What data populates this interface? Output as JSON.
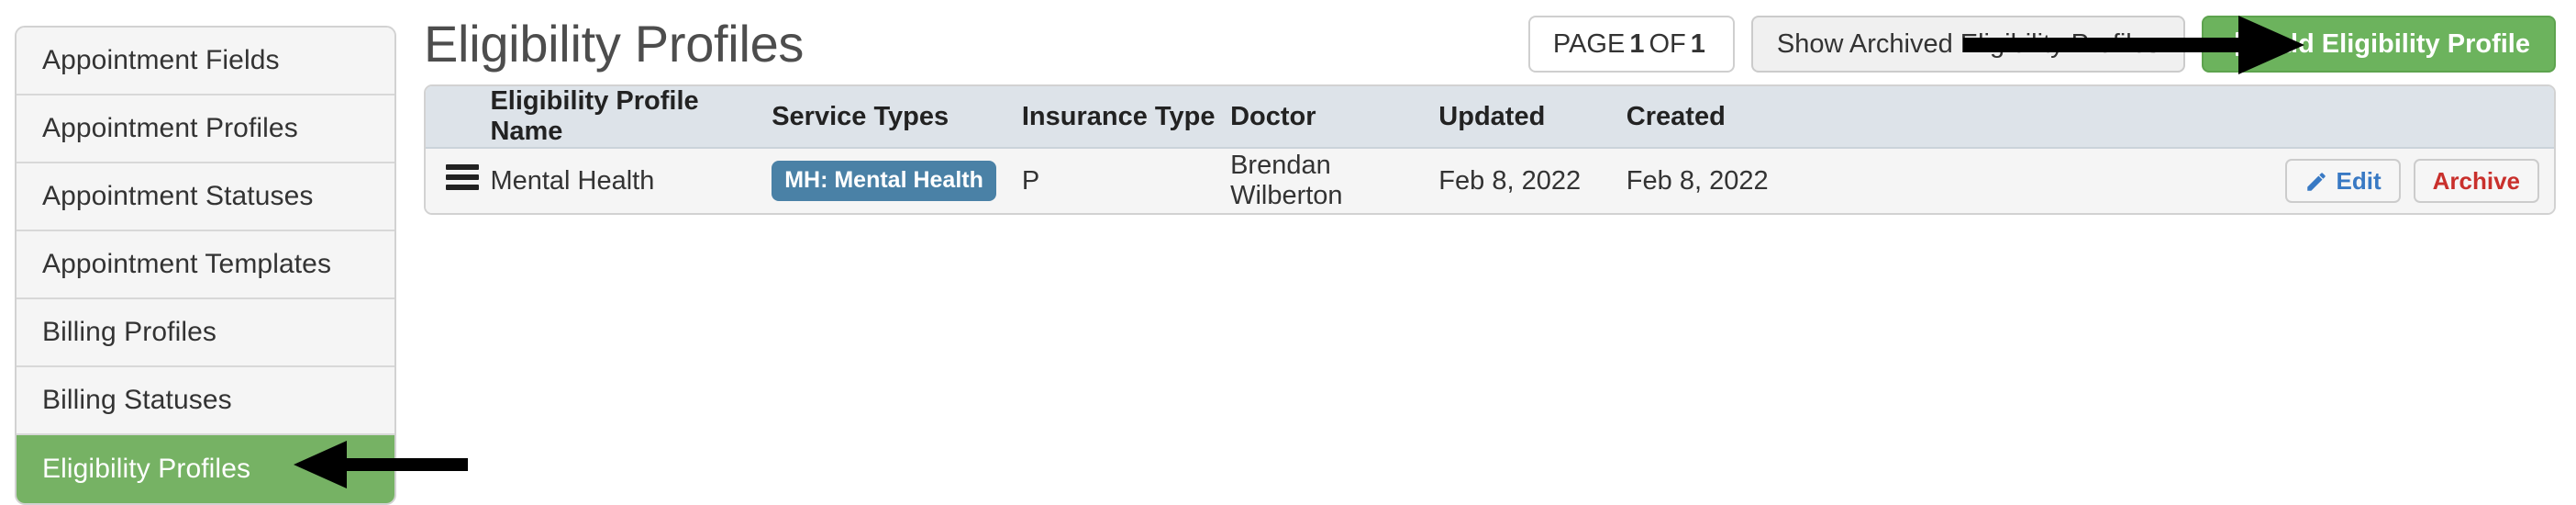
{
  "sidebar": {
    "items": [
      {
        "label": "Appointment Fields",
        "active": false
      },
      {
        "label": "Appointment Profiles",
        "active": false
      },
      {
        "label": "Appointment Statuses",
        "active": false
      },
      {
        "label": "Appointment Templates",
        "active": false
      },
      {
        "label": "Billing Profiles",
        "active": false
      },
      {
        "label": "Billing Statuses",
        "active": false
      },
      {
        "label": "Eligibility Profiles",
        "active": true
      }
    ]
  },
  "header": {
    "title": "Eligibility Profiles",
    "pagination": {
      "prefix": "PAGE",
      "current": "1",
      "middle": "OF",
      "total": "1"
    },
    "show_archived_label": "Show Archived Eligibility Profiles",
    "add_label": "Add Eligibility Profile",
    "add_icon": "plus-icon"
  },
  "table": {
    "columns": [
      "",
      "Eligibility Profile Name",
      "Service Types",
      "Insurance Type",
      "Doctor",
      "Updated",
      "Created",
      ""
    ],
    "rows": [
      {
        "handle_icon": "drag-handle-icon",
        "name": "Mental Health",
        "service_type": "MH: Mental Health",
        "insurance_type": "P",
        "doctor": "Brendan Wilberton",
        "updated": "Feb 8, 2022",
        "created": "Feb 8, 2022",
        "edit_label": "Edit",
        "edit_icon": "pencil-icon",
        "archive_label": "Archive"
      }
    ]
  },
  "colors": {
    "accent_green": "#6cb35d",
    "sidebar_active_green": "#76b264",
    "badge_blue": "#4a81a6",
    "edit_blue": "#3879c4",
    "archive_red": "#c9302c",
    "table_header_bg": "#dde3e9",
    "row_bg": "#f5f5f5",
    "annotation_arrow": "#000000"
  },
  "annotations": [
    {
      "name": "arrow-pointing-to-sidebar-eligibility-profiles",
      "direction": "left"
    },
    {
      "name": "arrow-pointing-to-add-eligibility-profile-button",
      "direction": "right"
    }
  ]
}
